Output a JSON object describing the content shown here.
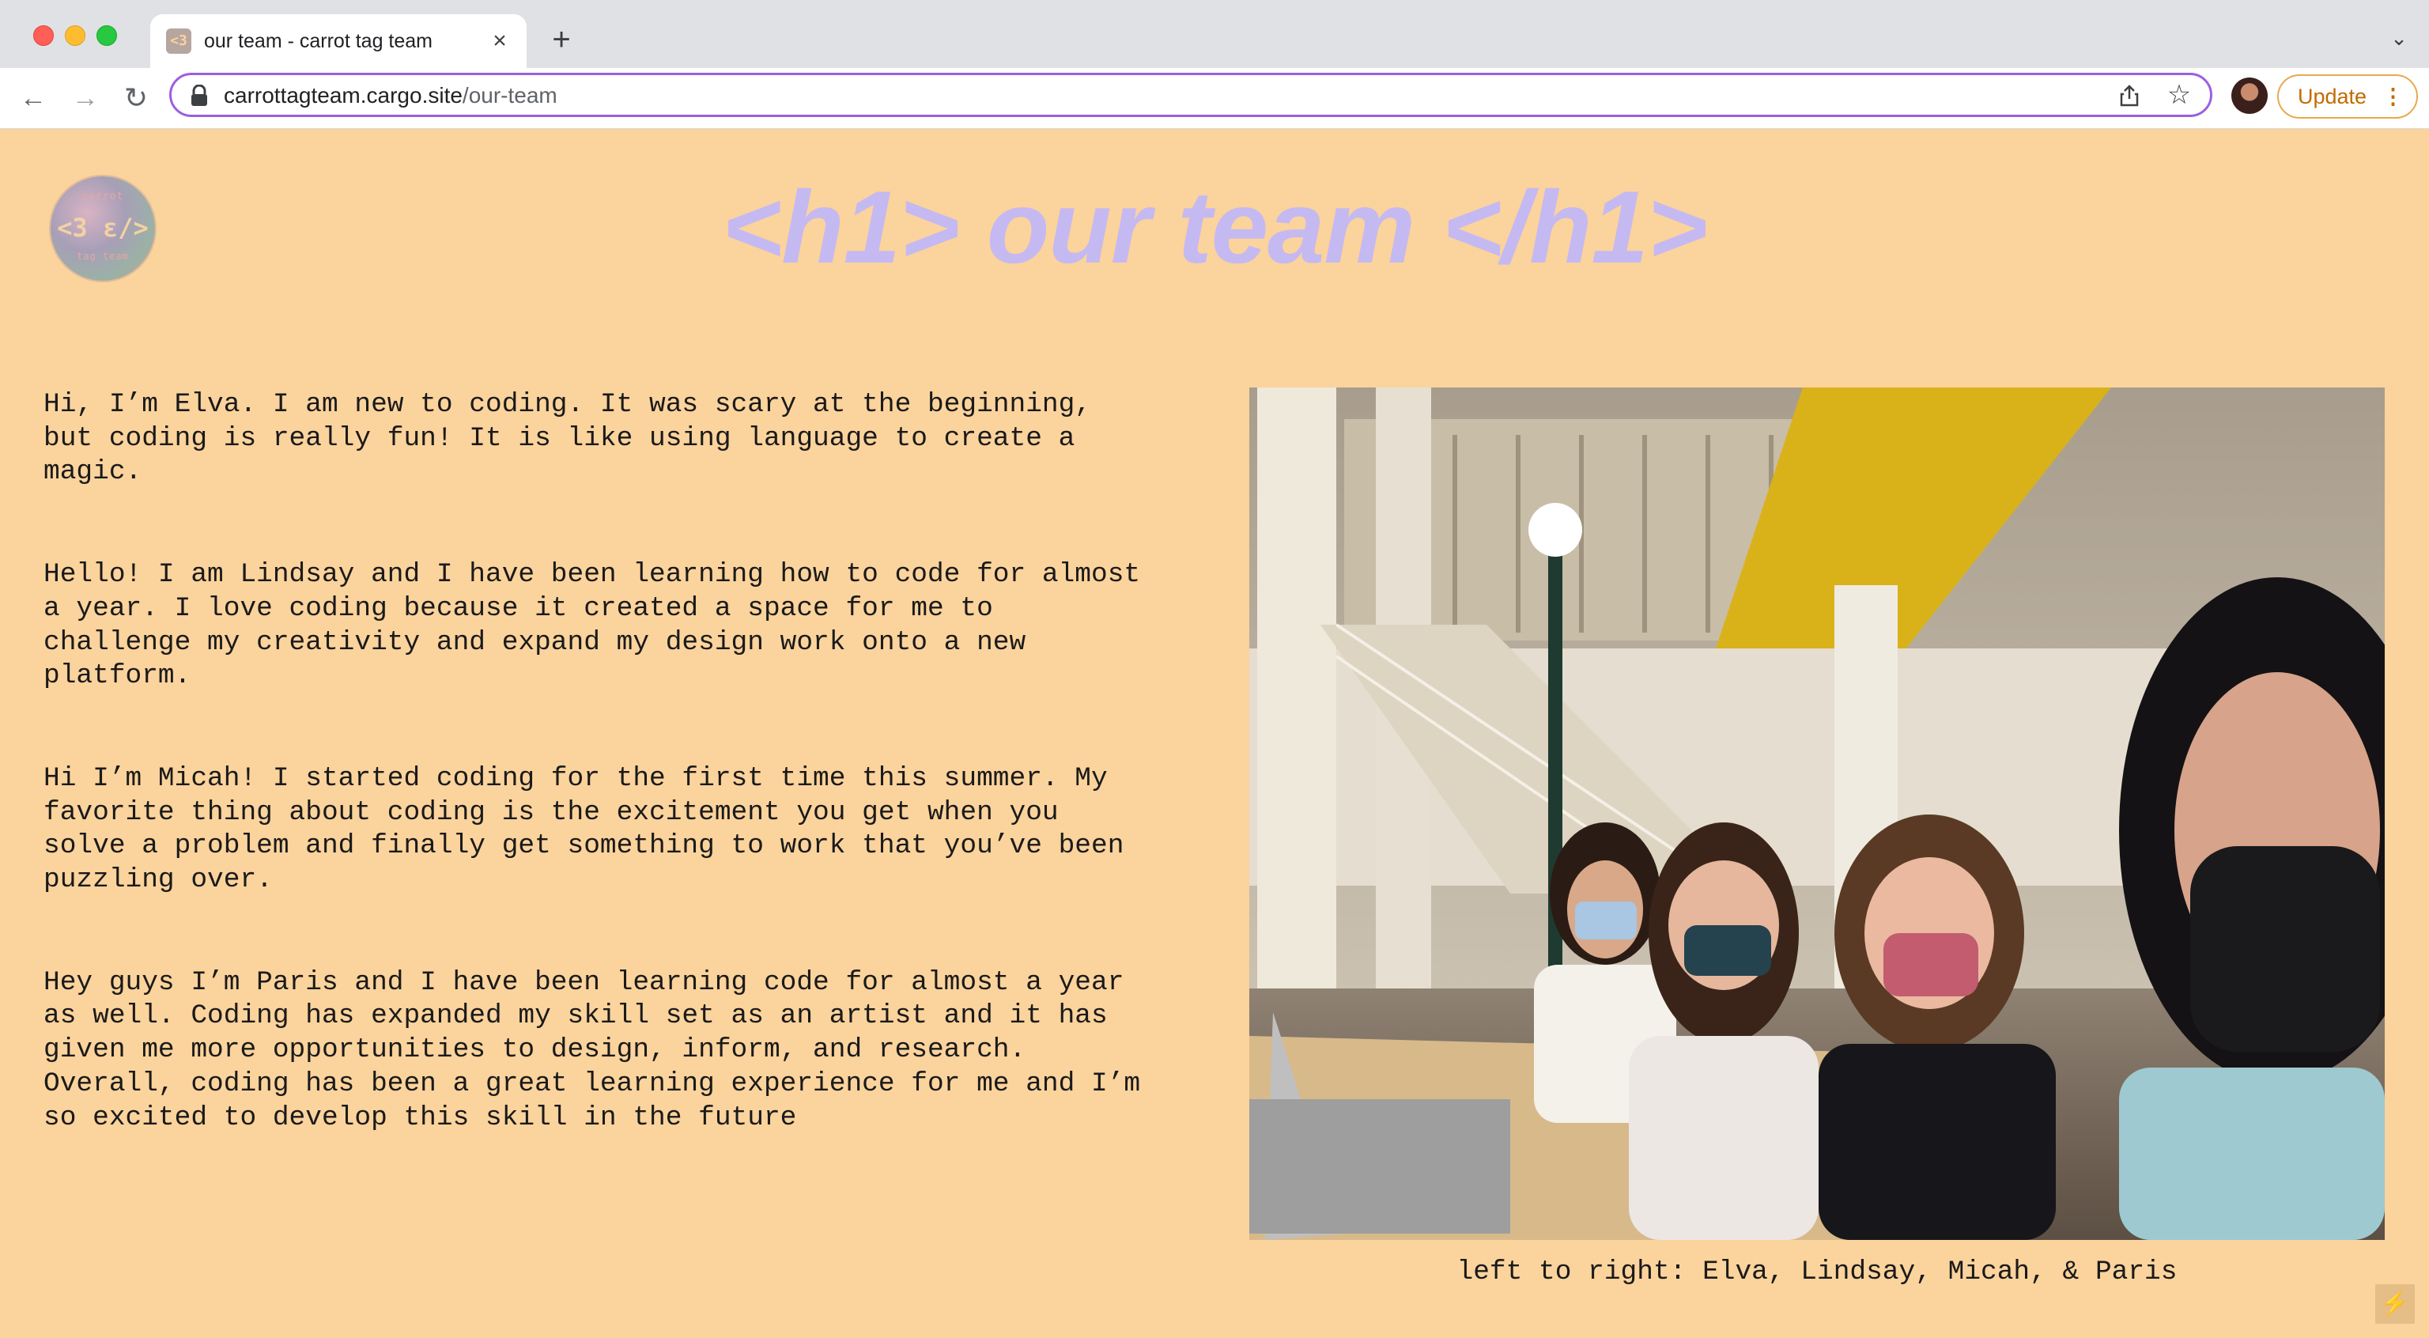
{
  "browser": {
    "tab_title": "our team - carrot tag team",
    "tab_favicon_icon": "carrot-tag-favicon",
    "tab_favicon_text": "<3",
    "close_icon": "×",
    "new_tab_icon": "+",
    "tab_menu_icon": "⌄",
    "back_icon": "←",
    "forward_icon": "→",
    "reload_icon": "↻",
    "url_host": "carrottagteam.cargo.site",
    "url_path": "/our-team",
    "star_icon": "☆",
    "update_label": "Update",
    "menu_dots": "⋮",
    "accent_color": "#9b5fe0",
    "update_color": "#c26b00"
  },
  "page": {
    "background_color": "#fbd39c",
    "title": "<h1> our team </h1>",
    "title_color": "#c5b9f2",
    "logo": {
      "top_text": "carrot",
      "mark": "<3 ε/>",
      "bottom_text": "tag team"
    },
    "bios": [
      "Hi, I’m Elva. I am new to coding. It was scary at the beginning,\nbut coding is really fun! It is like using language to create a\nmagic.",
      "Hello! I am Lindsay and I have been learning how to code for almost\na year. I love coding because it created a space for me to\nchallenge my creativity and expand my design work onto a new\nplatform.",
      "Hi I’m Micah! I started coding for the first time this summer. My\nfavorite thing about coding is the excitement you get when you\nsolve a problem and finally get something to work that you’ve been\npuzzling over.",
      "Hey guys I’m Paris and I have been learning code for almost a year\nas well. Coding has expanded my skill set as an artist and it has\ngiven me more opportunities to design, inform, and research.\nOverall, coding has been a great learning experience for me and I’m\nso excited to develop this skill in the future"
    ],
    "caption": "left to right: Elva, Lindsay, Micah, & Paris",
    "corner_icon": "⚡"
  }
}
